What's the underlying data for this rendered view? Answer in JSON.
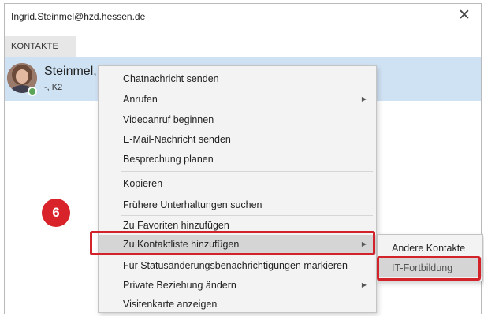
{
  "window": {
    "title": "Ingrid.Steinmel@hzd.hessen.de",
    "close_label": "✕"
  },
  "tabs": [
    {
      "label": "KONTAKTE",
      "active": true
    }
  ],
  "contact": {
    "name": "Steinmel, I",
    "subtitle": "-, K2",
    "status_color": "#5aa55a"
  },
  "context_menu": {
    "items": [
      {
        "label": "Chatnachricht senden",
        "submenu": false
      },
      {
        "label": "Anrufen",
        "submenu": true
      },
      {
        "label": "Videoanruf beginnen",
        "submenu": false
      },
      {
        "label": "E-Mail-Nachricht senden",
        "submenu": false
      },
      {
        "label": "Besprechung planen",
        "submenu": false
      },
      {
        "label": "Kopieren",
        "submenu": false
      },
      {
        "label": "Frühere Unterhaltungen suchen",
        "submenu": false
      },
      {
        "label": "Zu Favoriten hinzufügen",
        "submenu": false
      },
      {
        "label": "Zu Kontaktliste hinzufügen",
        "submenu": true,
        "highlighted": true
      },
      {
        "label": "Für Statusänderungsbenachrichtigungen markieren",
        "submenu": false
      },
      {
        "label": "Private Beziehung ändern",
        "submenu": true
      },
      {
        "label": "Visitenkarte anzeigen",
        "submenu": false
      }
    ],
    "arrow_glyph": "▶"
  },
  "submenu": {
    "items": [
      {
        "label": "Andere Kontakte"
      },
      {
        "label": "IT-Fortbildung",
        "selected": true
      }
    ]
  },
  "annotation": {
    "step_number": "6",
    "accent_color": "#d2222a"
  }
}
